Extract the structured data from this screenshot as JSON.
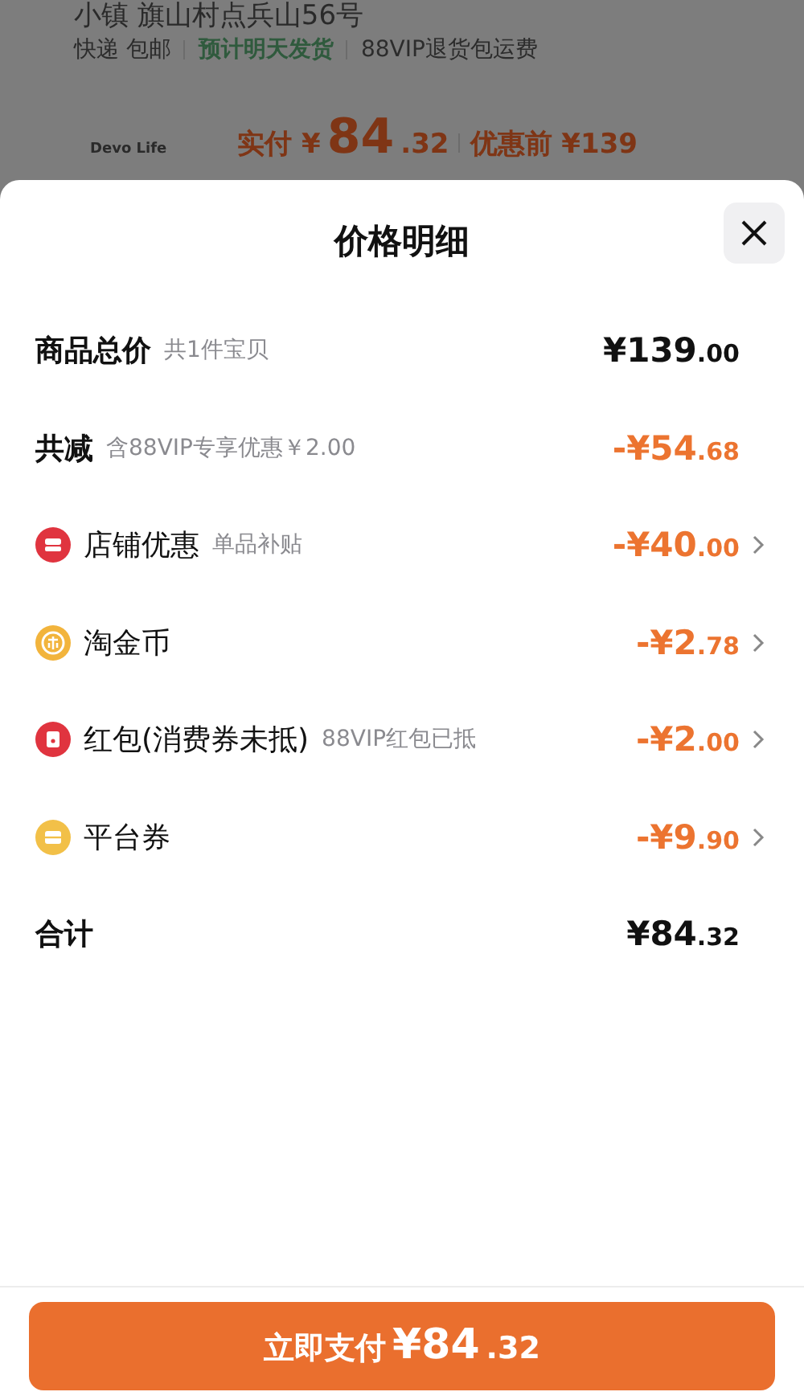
{
  "background_page": {
    "address": "小镇 旗山村点兵山56号",
    "shipping": [
      {
        "text": "快递 包邮",
        "kind": "plain"
      },
      {
        "text": "预计明天发货",
        "kind": "highlight"
      },
      {
        "text": "88VIP退货包运费",
        "kind": "plain"
      }
    ],
    "shop_logo": "Devo Life",
    "paid_label": "实付",
    "paid_currency": "¥",
    "paid_main": "84",
    "paid_cents": ".32",
    "before_label": "优惠前 ¥139"
  },
  "sheet": {
    "title": "价格明细",
    "rows": [
      {
        "kind": "total",
        "label": "商品总价",
        "note": "共1件宝贝",
        "main": "¥139",
        "cents": ".00",
        "chevron": false
      },
      {
        "kind": "discount",
        "label": "共减",
        "note": "含88VIP专享优惠￥2.00",
        "main": "-¥54",
        "cents": ".68",
        "chevron": false
      },
      {
        "kind": "item",
        "color": "#e0343f",
        "label": "店铺优惠",
        "note": "单品补贴",
        "main": "-¥40",
        "cents": ".00",
        "chevron": true
      },
      {
        "kind": "item",
        "color": "#f2b43c",
        "label": "淘金币",
        "main": "-¥2",
        "cents": ".78",
        "chevron": true
      },
      {
        "kind": "item",
        "color": "#e0343f",
        "label": "红包(消费券未抵)",
        "note": "88VIP红包已抵",
        "main": "-¥2",
        "cents": ".00",
        "chevron": true
      },
      {
        "kind": "item",
        "color": "#f2c048",
        "label": "平台券",
        "main": "-¥9",
        "cents": ".90",
        "chevron": true
      },
      {
        "kind": "total",
        "label": "合计",
        "main": "¥84",
        "cents": ".32",
        "chevron": false
      }
    ],
    "pay_button": {
      "label": "立即支付",
      "main": "¥84",
      "cents": ".32"
    }
  }
}
